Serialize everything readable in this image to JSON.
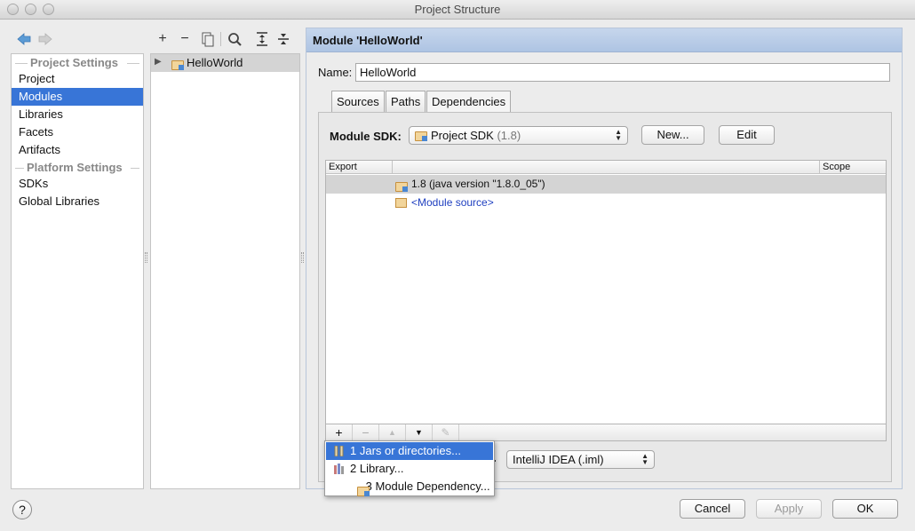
{
  "window": {
    "title": "Project Structure"
  },
  "left_nav": {
    "groups": [
      {
        "label": "Project Settings",
        "items": [
          "Project",
          "Modules",
          "Libraries",
          "Facets",
          "Artifacts"
        ]
      },
      {
        "label": "Platform Settings",
        "items": [
          "SDKs",
          "Global Libraries"
        ]
      }
    ],
    "selected": "Modules"
  },
  "module_tree": {
    "items": [
      {
        "label": "HelloWorld"
      }
    ]
  },
  "module": {
    "header": "Module 'HelloWorld'",
    "name_label": "Name:",
    "name_value": "HelloWorld",
    "tabs": [
      "Sources",
      "Paths",
      "Dependencies"
    ],
    "active_tab": "Dependencies",
    "sdk_label": "Module SDK:",
    "sdk_value": "Project SDK",
    "sdk_version": "(1.8)",
    "new_button": "New...",
    "edit_button": "Edit",
    "table": {
      "columns": [
        "Export",
        "",
        "Scope"
      ],
      "rows": [
        {
          "text": "1.8 (java version \"1.8.0_05\")",
          "style": "normal"
        },
        {
          "text": "<Module source>",
          "style": "link"
        }
      ]
    },
    "format_value": "IntelliJ IDEA (.iml)"
  },
  "add_menu": {
    "items": [
      {
        "label": "1  Jars or directories...",
        "icon": "jar-icon"
      },
      {
        "label": "2  Library...",
        "icon": "library-icon"
      },
      {
        "label": "3  Module Dependency...",
        "icon": "module-icon"
      }
    ],
    "selected_index": 0
  },
  "dialog_buttons": {
    "help": "?",
    "cancel": "Cancel",
    "apply": "Apply",
    "ok": "OK"
  },
  "colors": {
    "selection": "#3875d7",
    "header": "#b8cbe6",
    "link": "#2040c0"
  }
}
